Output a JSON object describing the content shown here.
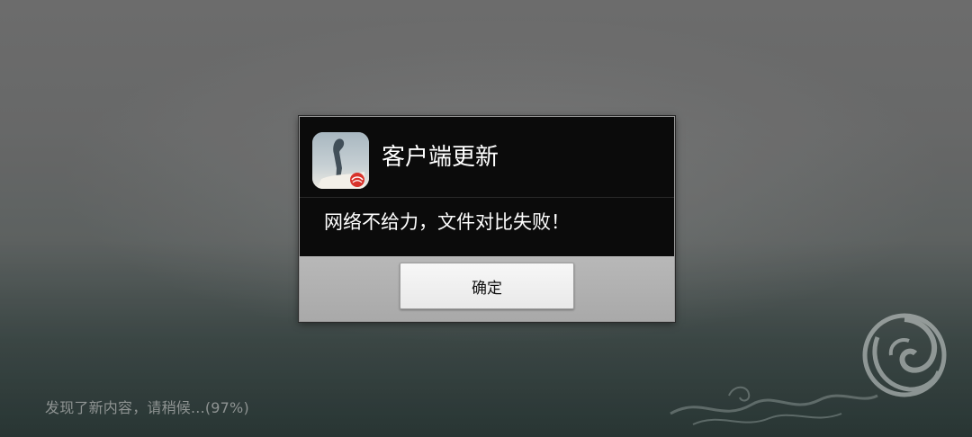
{
  "background": {
    "progress_text": "发现了新内容，请稍候...(97%)",
    "logo_icon": "swirl-logo-icon"
  },
  "dialog": {
    "title": "客户端更新",
    "message": "网络不给力，文件对比失败！",
    "ok_button_label": "确定",
    "app_icon": "app-icon"
  }
}
